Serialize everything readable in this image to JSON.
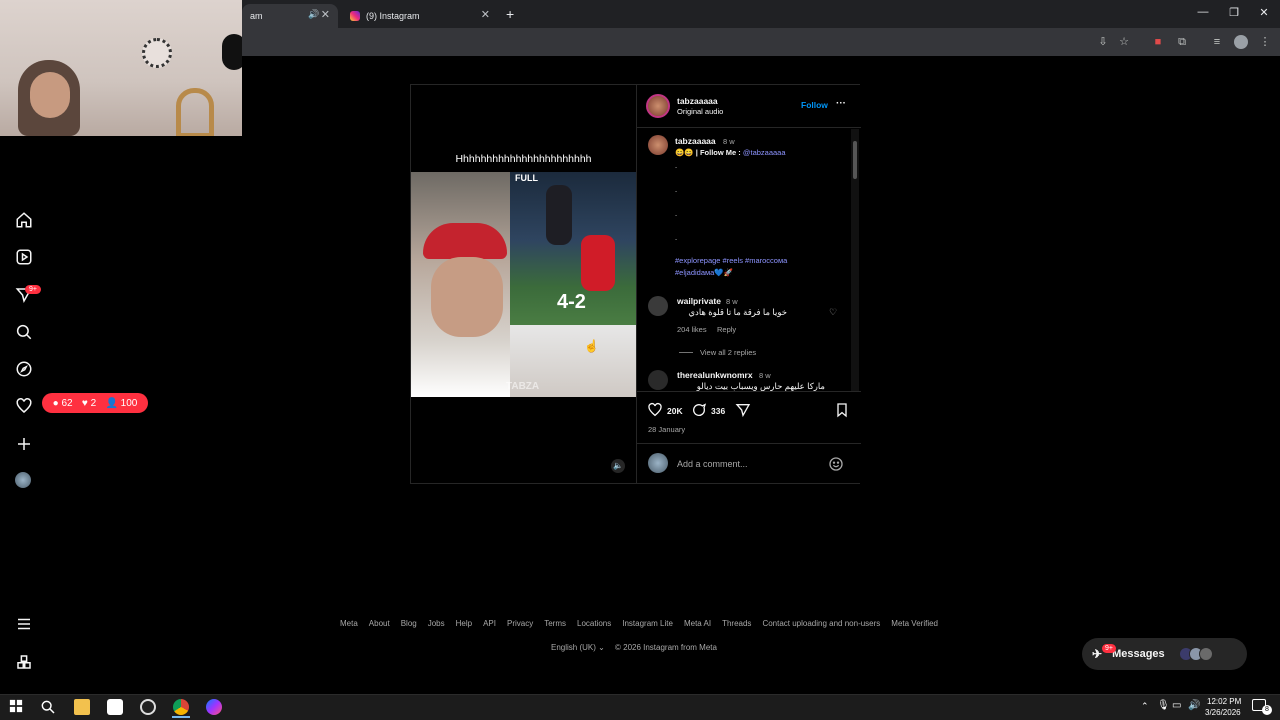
{
  "browser": {
    "tabs": [
      {
        "title": "am",
        "active": false
      },
      {
        "title": "(9) Instagram",
        "active": true
      }
    ],
    "new_tab": "+",
    "window_controls": [
      "—",
      "❐",
      "✕"
    ]
  },
  "nav": {
    "notifications_badge": "9+",
    "stats": {
      "comments": "62",
      "likes": "2",
      "followers": "100"
    }
  },
  "post": {
    "author": "tabzaaaaa",
    "audio": "Original audio",
    "follow": "Follow",
    "more": "···",
    "media": {
      "caption_text": "Hhhhhhhhhhhhhhhhhhhhhhh",
      "overlay_text": "FULL",
      "score": "4-2",
      "watermark": "TABZA"
    },
    "caption": {
      "user": "tabzaaaaa",
      "time": "8 w",
      "line": "😄😄 | Follow Me :",
      "mention": "@tabzaaaaa",
      "dots": [
        ".",
        ".",
        ".",
        "."
      ],
      "hashtags_1": "#explorepage #reels #maroccoмa",
      "hashtags_2": "#eljadidaмa💙🚀"
    },
    "comments": [
      {
        "user": "wailprivate",
        "time": "8 w",
        "text": "خويا ما فرقة ما تا قلوة هادي",
        "likes": "204 likes",
        "reply": "Reply",
        "view_replies": "View all 2 replies"
      },
      {
        "user": "therealunkwnomrx",
        "time": "8 w",
        "text": "ماركا عليهم حارس ويسباب بيت ديالو"
      }
    ],
    "likes_count": "20K",
    "comments_count": "336",
    "date": "28 January",
    "comment_placeholder": "Add a comment..."
  },
  "footer": {
    "links": [
      "Meta",
      "About",
      "Blog",
      "Jobs",
      "Help",
      "API",
      "Privacy",
      "Terms",
      "Locations",
      "Instagram Lite",
      "Meta AI",
      "Threads",
      "Contact uploading and non-users",
      "Meta Verified"
    ],
    "language": "English (UK)",
    "copyright": "© 2026 Instagram from Meta"
  },
  "messages": {
    "label": "Messages",
    "badge": "9+"
  },
  "taskbar": {
    "time": "12:02 PM",
    "date": "3/26/2026",
    "notif": "8"
  },
  "colors": {
    "accent": "#0095f6",
    "link": "#8d94ff",
    "badge": "#ff3040"
  }
}
